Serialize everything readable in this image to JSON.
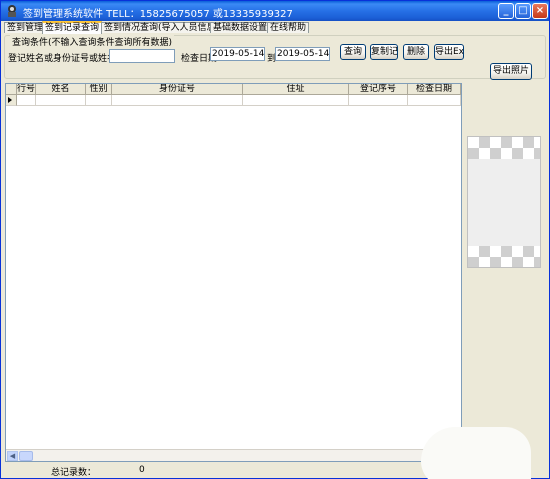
{
  "window": {
    "title": "签到管理系统软件 TELL：15825675057 或13335939327",
    "minimize": "_",
    "maximize": "□",
    "close": "×"
  },
  "tabs": [
    {
      "label": "签到管理",
      "active": false
    },
    {
      "label": "签到记录查询",
      "active": true
    },
    {
      "label": "签到情况查询(导入人员信息)",
      "active": false
    },
    {
      "label": "基础数据设置",
      "active": false
    },
    {
      "label": "在线帮助",
      "active": false
    }
  ],
  "query": {
    "group_title": "查询条件(不输入查询条件查询所有数据)",
    "name_label": "登记姓名或身份证号或姓名拼",
    "name_value": "",
    "date_label": "检查日期",
    "date_from": "2019-05-14",
    "to_label": "到",
    "date_to": "2019-05-14",
    "query_button": "查询",
    "copy_button": "复制记录",
    "delete_button": "删除",
    "export_excel_button": "导出Excel",
    "export_photo_button": "导出照片"
  },
  "table": {
    "columns": [
      "行号",
      "姓名",
      "性别",
      "身份证号",
      "住址",
      "登记序号",
      "检查日期"
    ],
    "rows": [
      [
        "",
        "",
        "",
        "",
        "",
        "",
        ""
      ]
    ]
  },
  "status": {
    "total_label": "总记录数：",
    "total_value": "0"
  },
  "colors": {
    "titlebar": "#2670e6",
    "active_tab_accent": "#ffc83c",
    "window_bg": "#ece9d8"
  }
}
